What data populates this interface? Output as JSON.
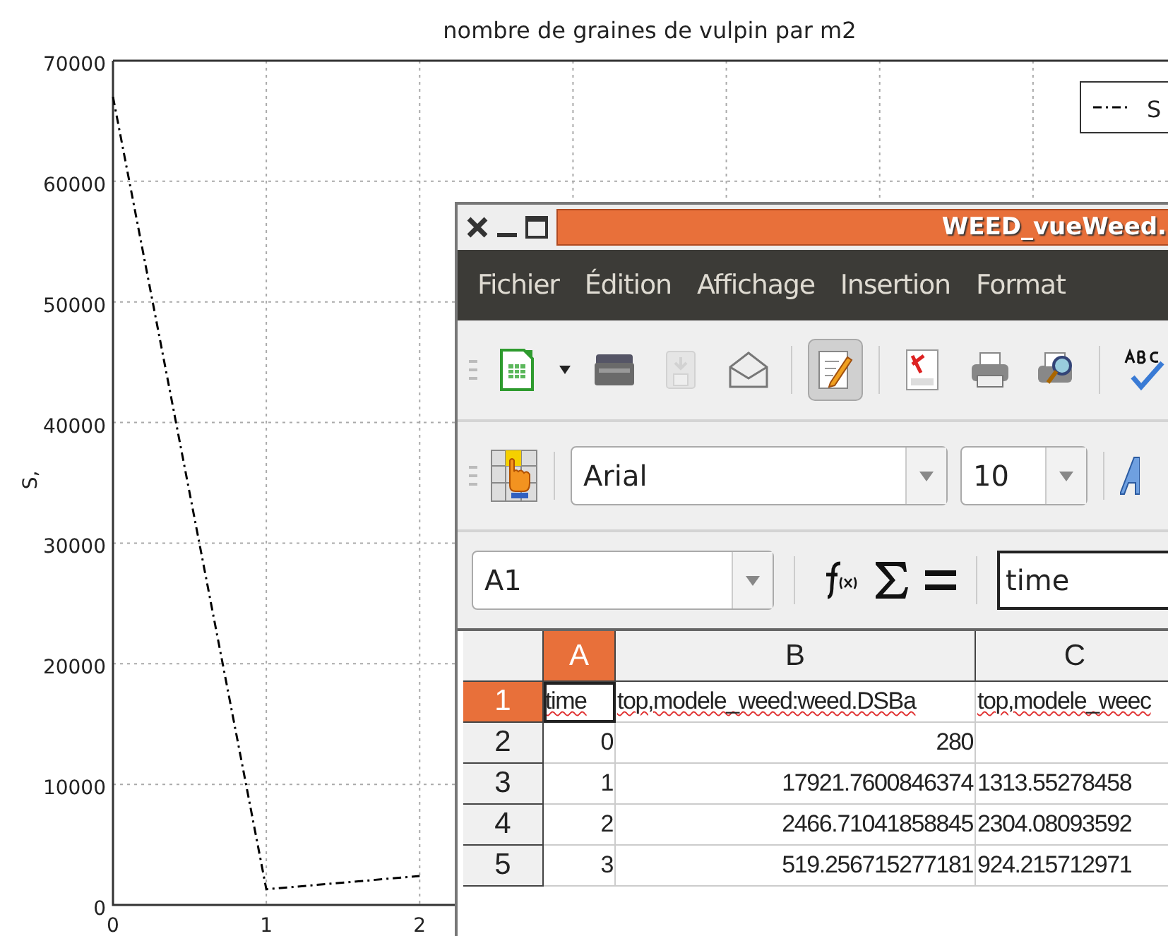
{
  "chart": {
    "chart_data": {
      "type": "line",
      "title": "nombre de graines de vulpin par m2",
      "ylabel": "S,",
      "x": [
        0,
        1,
        2
      ],
      "series": [
        {
          "name": "S",
          "color": "#000000",
          "line_style": "dashdot",
          "values": [
            67000,
            1300,
            2400
          ]
        }
      ],
      "xlim": [
        0,
        7
      ],
      "ylim": [
        0,
        70000
      ],
      "xticks": [
        0,
        1,
        2
      ],
      "yticks": [
        0,
        10000,
        20000,
        30000,
        40000,
        50000,
        60000,
        70000
      ],
      "grid": true,
      "legend": true
    }
  },
  "window": {
    "title": "WEED_vueWeed.",
    "menu": [
      "Fichier",
      "Édition",
      "Affichage",
      "Insertion",
      "Format"
    ],
    "toolbar": [
      {
        "kind": "new",
        "disabled": false,
        "pressed": false
      },
      {
        "kind": "dropdown",
        "disabled": false,
        "pressed": false
      },
      {
        "kind": "open",
        "disabled": false,
        "pressed": false
      },
      {
        "kind": "save",
        "disabled": true,
        "pressed": false
      },
      {
        "kind": "mail",
        "disabled": false,
        "pressed": false
      },
      {
        "kind": "edit",
        "disabled": false,
        "pressed": true
      },
      {
        "kind": "pdf",
        "disabled": false,
        "pressed": false
      },
      {
        "kind": "print",
        "disabled": false,
        "pressed": false
      },
      {
        "kind": "preview",
        "disabled": false,
        "pressed": false
      },
      {
        "kind": "spell",
        "disabled": false,
        "pressed": false
      }
    ],
    "font_name": "Arial",
    "font_size": "10",
    "name_box": "A1",
    "formula": "time",
    "columns": [
      {
        "label": "A",
        "selected": true
      },
      {
        "label": "B",
        "selected": false
      },
      {
        "label": "C",
        "selected": false
      }
    ],
    "rows": [
      {
        "label": "1",
        "selected": true,
        "cells": [
          "time",
          "top,modele_weed:weed.DSBa",
          "top,modele_weec"
        ]
      },
      {
        "label": "2",
        "selected": false,
        "cells": [
          "0",
          "280",
          ""
        ]
      },
      {
        "label": "3",
        "selected": false,
        "cells": [
          "1",
          "17921.7600846374",
          "1313.55278458"
        ]
      },
      {
        "label": "4",
        "selected": false,
        "cells": [
          "2",
          "2466.71041858845",
          "2304.08093592"
        ]
      },
      {
        "label": "5",
        "selected": false,
        "cells": [
          "3",
          "519.256715277181",
          "924.215712971"
        ]
      }
    ]
  }
}
